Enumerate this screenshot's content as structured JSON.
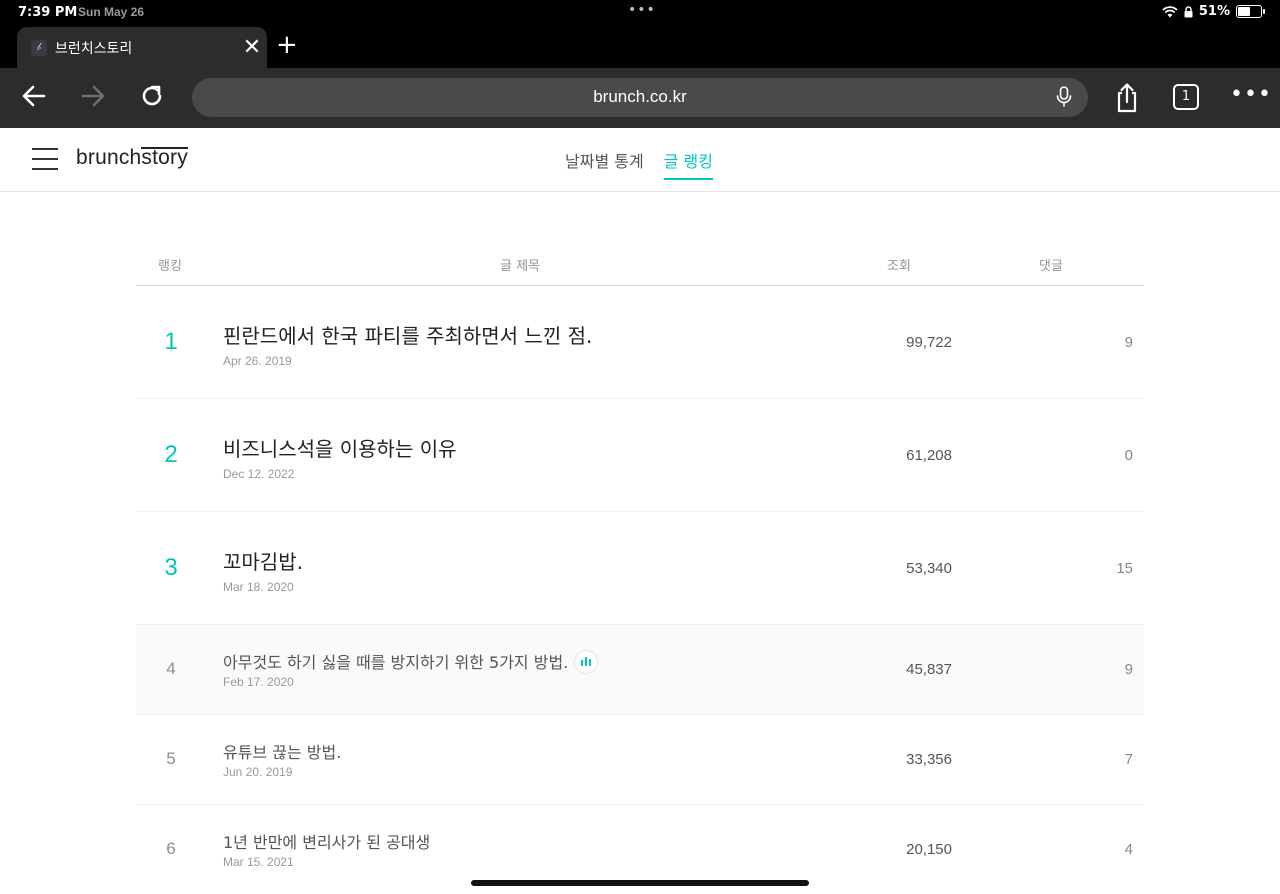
{
  "status": {
    "time": "7:39 PM",
    "date": "Sun May 26",
    "battery": "51%"
  },
  "browser": {
    "tab_title": "브런치스토리",
    "url": "brunch.co.kr",
    "tab_count": "1"
  },
  "site": {
    "logo_main": "brunch",
    "logo_story": "story",
    "nav": [
      {
        "label": "날짜별 통계",
        "active": false
      },
      {
        "label": "글 랭킹",
        "active": true
      }
    ],
    "accent_color": "#00c6be"
  },
  "table": {
    "headers": {
      "rank": "랭킹",
      "title": "글 제목",
      "views": "조회",
      "comments": "댓글"
    },
    "rows": [
      {
        "rank": "1",
        "title": "핀란드에서 한국 파티를 주최하면서 느낀 점.",
        "date": "Apr 26. 2019",
        "views": "99,722",
        "comments": "9"
      },
      {
        "rank": "2",
        "title": "비즈니스석을 이용하는 이유",
        "date": "Dec 12. 2022",
        "views": "61,208",
        "comments": "0"
      },
      {
        "rank": "3",
        "title": "꼬마김밥.",
        "date": "Mar 18. 2020",
        "views": "53,340",
        "comments": "15"
      },
      {
        "rank": "4",
        "title": "아무것도 하기 싫을 때를 방지하기 위한 5가지 방법.",
        "date": "Feb 17. 2020",
        "views": "45,837",
        "comments": "9"
      },
      {
        "rank": "5",
        "title": "유튜브 끊는 방법.",
        "date": "Jun 20. 2019",
        "views": "33,356",
        "comments": "7"
      },
      {
        "rank": "6",
        "title": "1년 반만에 변리사가 된 공대생",
        "date": "Mar 15. 2021",
        "views": "20,150",
        "comments": "4"
      }
    ]
  }
}
